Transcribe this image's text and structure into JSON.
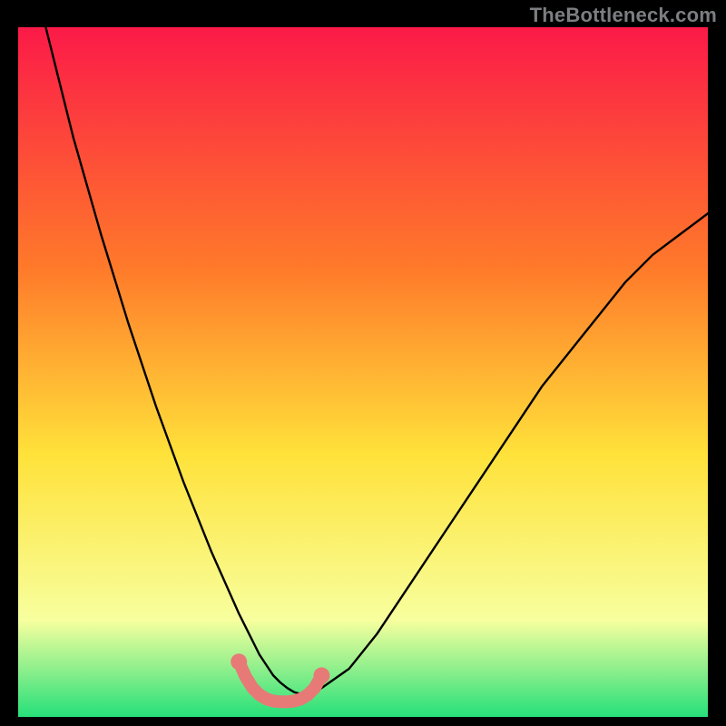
{
  "watermark": "TheBottleneck.com",
  "colors": {
    "page_bg": "#000000",
    "grad_top": "#fb1a48",
    "grad_mid1": "#ff7a2a",
    "grad_mid2": "#ffe23a",
    "grad_low": "#f7ff9e",
    "grad_base": "#26e07a",
    "curve": "#000000",
    "marker_fill": "#e77a77",
    "marker_stroke": "#db5d5a"
  },
  "chart_data": {
    "type": "line",
    "title": "",
    "xlabel": "",
    "ylabel": "",
    "xlim": [
      0,
      100
    ],
    "ylim": [
      0,
      100
    ],
    "series": [
      {
        "name": "bottleneck-curve",
        "x": [
          0,
          4,
          8,
          12,
          16,
          20,
          24,
          28,
          32,
          33,
          34,
          35,
          36,
          37,
          38,
          39,
          40,
          41,
          42,
          43,
          44,
          48,
          52,
          56,
          60,
          64,
          68,
          72,
          76,
          80,
          84,
          88,
          92,
          96,
          100
        ],
        "y": [
          120,
          100,
          84,
          70,
          57,
          45,
          34,
          24,
          15,
          13,
          11,
          9,
          7.5,
          6,
          5,
          4.2,
          3.6,
          3.3,
          3.3,
          3.6,
          4.2,
          7,
          12,
          18,
          24,
          30,
          36,
          42,
          48,
          53,
          58,
          63,
          67,
          70,
          73
        ]
      },
      {
        "name": "sweet-spot-highlight",
        "x": [
          32,
          33,
          34,
          35,
          36,
          37,
          38,
          39,
          40,
          41,
          42,
          43,
          44
        ],
        "y": [
          8,
          5.8,
          4.2,
          3.2,
          2.6,
          2.3,
          2.2,
          2.2,
          2.3,
          2.6,
          3.2,
          4.2,
          6
        ]
      }
    ],
    "gradient_stops": [
      {
        "pct": 0,
        "color": "#fb1a48"
      },
      {
        "pct": 35,
        "color": "#ff7a2a"
      },
      {
        "pct": 62,
        "color": "#ffe23a"
      },
      {
        "pct": 86,
        "color": "#f7ff9e"
      },
      {
        "pct": 100,
        "color": "#26e07a"
      }
    ]
  }
}
